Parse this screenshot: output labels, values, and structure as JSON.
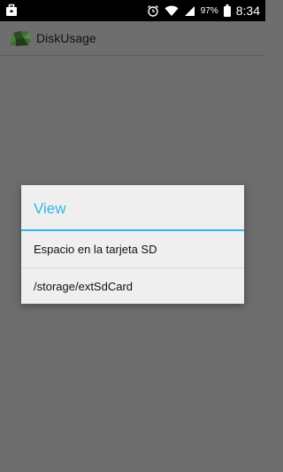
{
  "status_bar": {
    "battery": "97%",
    "time": "8:34",
    "icons": [
      "briefcase-icon",
      "alarm-icon",
      "wifi-icon",
      "signal-icon",
      "battery-icon"
    ]
  },
  "action_bar": {
    "title": "DiskUsage",
    "icon": "disk-usage-app-icon"
  },
  "dialog": {
    "title": "View",
    "accent": "#31b6e7",
    "items": [
      {
        "label": "Espacio en la tarjeta SD"
      },
      {
        "label": "/storage/extSdCard"
      }
    ]
  }
}
